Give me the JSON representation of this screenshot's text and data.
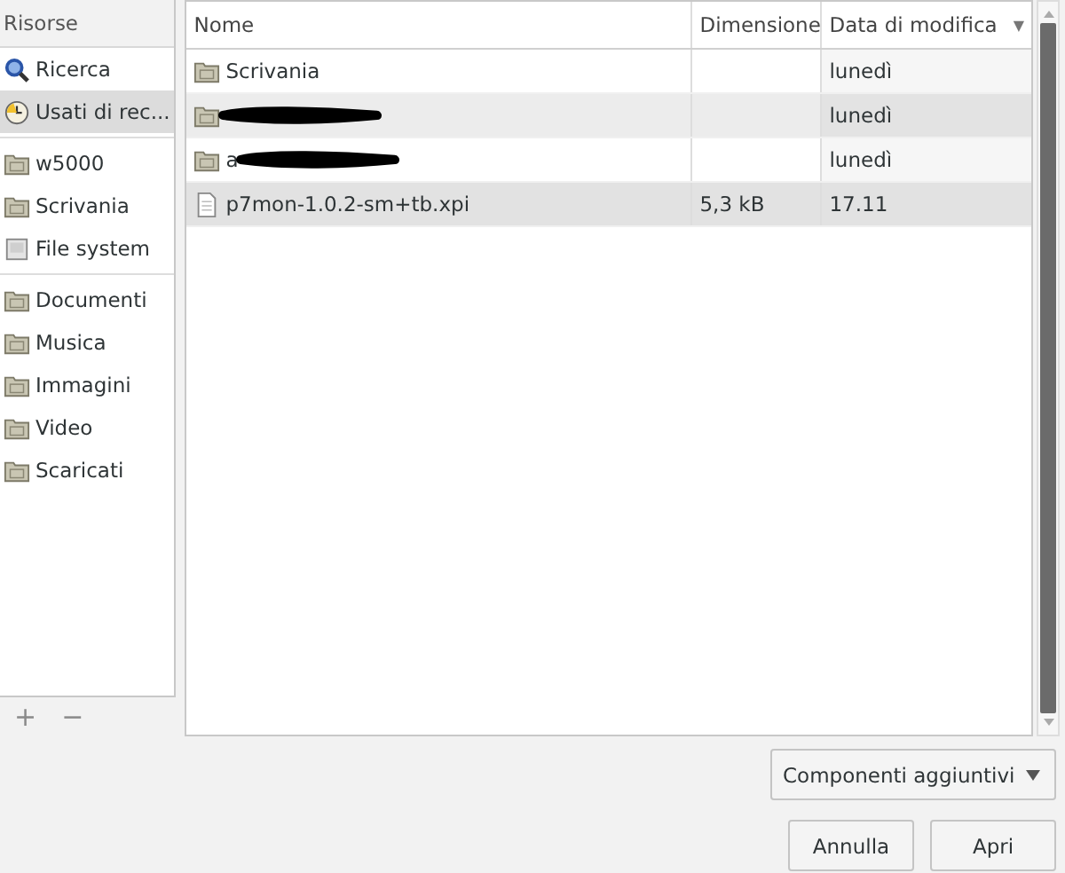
{
  "sidebar": {
    "header": "Risorse",
    "groups": [
      [
        {
          "label": "Ricerca",
          "kind": "search",
          "selected": false
        },
        {
          "label": "Usati di rec...",
          "kind": "clock",
          "selected": true
        }
      ],
      [
        {
          "label": "w5000",
          "kind": "folder",
          "selected": false
        },
        {
          "label": "Scrivania",
          "kind": "folder",
          "selected": false
        },
        {
          "label": "File system",
          "kind": "drive",
          "selected": false
        }
      ],
      [
        {
          "label": "Documenti",
          "kind": "folder",
          "selected": false
        },
        {
          "label": "Musica",
          "kind": "folder",
          "selected": false
        },
        {
          "label": "Immagini",
          "kind": "folder",
          "selected": false
        },
        {
          "label": "Video",
          "kind": "folder",
          "selected": false
        },
        {
          "label": "Scaricati",
          "kind": "folder",
          "selected": false
        }
      ]
    ],
    "add_button": "+",
    "remove_button": "−"
  },
  "table": {
    "columns": [
      "Nome",
      "Dimensione",
      "Data di modifica"
    ],
    "sort_indicator": "▼",
    "rows": [
      {
        "kind": "folder",
        "name": "Scrivania",
        "redacted": false,
        "size": "",
        "modified": "lunedì",
        "hover": false,
        "selected": false
      },
      {
        "kind": "folder",
        "redacted": true,
        "modified": "lunedì",
        "hover": true,
        "selected": false
      },
      {
        "kind": "folder",
        "name": "a",
        "redacted": true,
        "modified": "lunedì",
        "hover": false,
        "selected": false
      },
      {
        "kind": "file",
        "name": "p7mon-1.0.2-sm+tb.xpi",
        "redacted": false,
        "size": "5,3 kB",
        "modified": "17.11",
        "hover": false,
        "selected": true
      }
    ]
  },
  "filter": {
    "value": "Componenti aggiuntivi"
  },
  "buttons": [
    "Annulla",
    "Apri"
  ]
}
